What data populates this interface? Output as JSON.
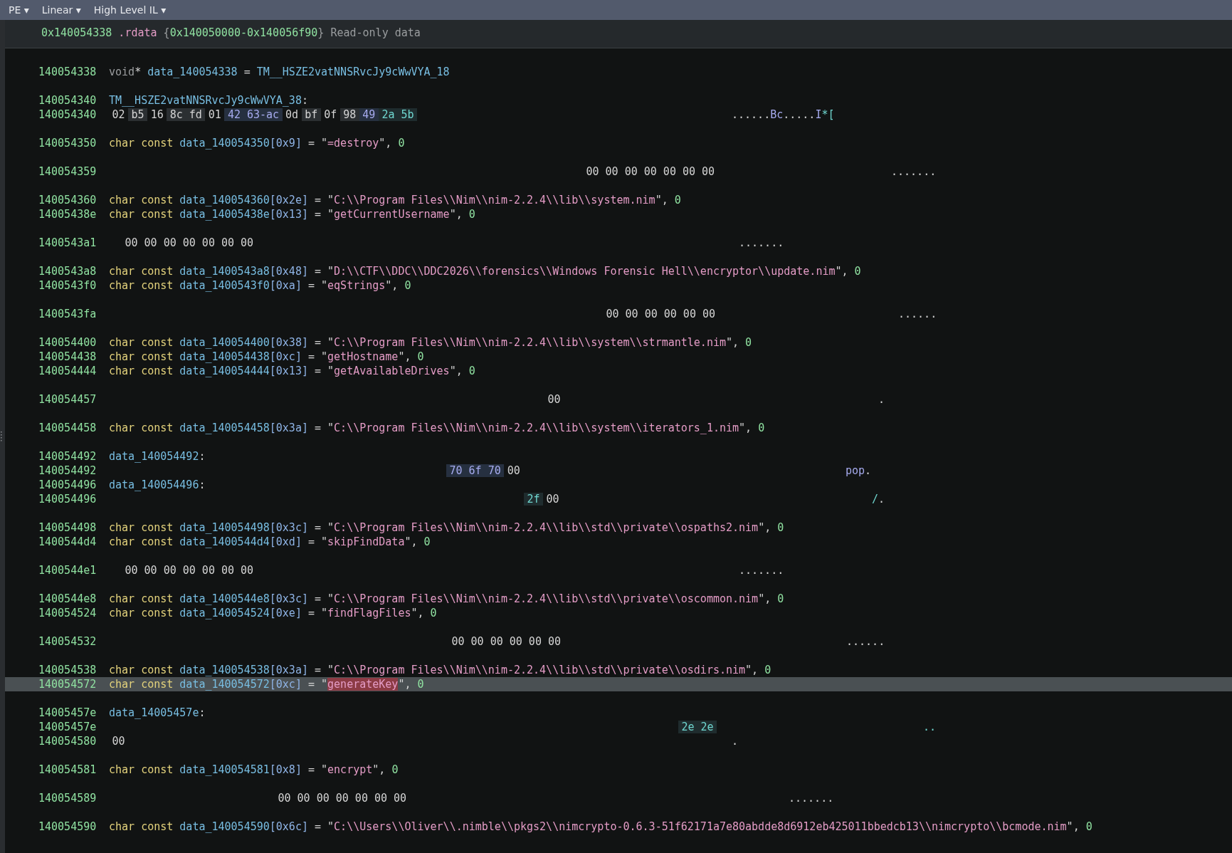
{
  "toolbar": {
    "menus": [
      {
        "label": "PE ▾"
      },
      {
        "label": "Linear ▾"
      },
      {
        "label": "High Level IL ▾"
      }
    ]
  },
  "section_header": {
    "segments": [
      {
        "text": "0x140054338",
        "kind": "number"
      },
      {
        "text": " .rdata",
        "kind": "string"
      },
      {
        "text": " {",
        "kind": "dim"
      },
      {
        "text": "0x140050000-0x140056f90",
        "kind": "number"
      },
      {
        "text": "} Read-only data",
        "kind": "dim"
      }
    ]
  },
  "blocks": [
    [
      {
        "address": "140054338",
        "kind": "code",
        "selected": false,
        "segments": [
          {
            "text": "void",
            "kind": "void"
          },
          {
            "text": "* ",
            "kind": "punct"
          },
          {
            "text": "data_140054338",
            "kind": "name"
          },
          {
            "text": " = ",
            "kind": "punct"
          },
          {
            "text": "TM__HSZE2vatNNSRvcJy9cWwVYA_18",
            "kind": "name"
          }
        ]
      }
    ],
    [
      {
        "address": "140054340",
        "kind": "code",
        "selected": false,
        "segments": [
          {
            "text": "TM__HSZE2vatNNSRvcJy9cWwVYA_38",
            "kind": "name"
          },
          {
            "text": ":",
            "kind": "punct"
          }
        ]
      },
      {
        "address": "140054340",
        "kind": "hex",
        "selected": false,
        "bytes": [
          {
            "text": "02",
            "kind": "plain"
          },
          {
            "text": "b5",
            "kind": "high"
          },
          {
            "text": "16",
            "kind": "plain"
          },
          {
            "text": "8c",
            "kind": "high"
          },
          {
            "text": "fd",
            "kind": "high"
          },
          {
            "text": "01",
            "kind": "plain"
          },
          {
            "text": "42",
            "kind": "letter"
          },
          {
            "text": "63-ac",
            "kind": "letter"
          },
          {
            "text": "0d",
            "kind": "plain"
          },
          {
            "text": "bf",
            "kind": "high"
          },
          {
            "text": "0f",
            "kind": "plain"
          },
          {
            "text": "98",
            "kind": "high"
          },
          {
            "text": "49",
            "kind": "letter"
          },
          {
            "text": "2a",
            "kind": "symbol"
          },
          {
            "text": "5b",
            "kind": "symbol"
          }
        ],
        "ascii": [
          {
            "text": "......",
            "kind": "plain"
          },
          {
            "text": "Bc",
            "kind": "letter"
          },
          {
            "text": ".....",
            "kind": "plain"
          },
          {
            "text": "I",
            "kind": "letter"
          },
          {
            "text": "*[",
            "kind": "symbol"
          }
        ]
      }
    ],
    [
      {
        "address": "140054350",
        "kind": "code",
        "selected": false,
        "segments": [
          {
            "text": "char const ",
            "kind": "type"
          },
          {
            "text": "data_140054350",
            "kind": "name"
          },
          {
            "text": "[0x9]",
            "kind": "index"
          },
          {
            "text": " = \"",
            "kind": "punct"
          },
          {
            "text": "=destroy",
            "kind": "string"
          },
          {
            "text": "\", ",
            "kind": "punct"
          },
          {
            "text": "0",
            "kind": "number"
          }
        ]
      }
    ],
    [
      {
        "address": "140054359",
        "kind": "hex",
        "selected": false,
        "bytes": [
          {
            "text": "00 00 00 00 00 00 00",
            "kind": "plain"
          }
        ],
        "ascii": [
          {
            "text": ".......",
            "kind": "plain"
          }
        ]
      }
    ],
    [
      {
        "address": "140054360",
        "kind": "code",
        "selected": false,
        "segments": [
          {
            "text": "char const ",
            "kind": "type"
          },
          {
            "text": "data_140054360",
            "kind": "name"
          },
          {
            "text": "[0x2e]",
            "kind": "index"
          },
          {
            "text": " = \"",
            "kind": "punct"
          },
          {
            "text": "C:\\\\Program Files\\\\Nim\\\\nim-2.2.4\\\\lib\\\\system.nim",
            "kind": "string"
          },
          {
            "text": "\", ",
            "kind": "punct"
          },
          {
            "text": "0",
            "kind": "number"
          }
        ]
      },
      {
        "address": "14005438e",
        "kind": "code",
        "selected": false,
        "segments": [
          {
            "text": "char const ",
            "kind": "type"
          },
          {
            "text": "data_14005438e",
            "kind": "name"
          },
          {
            "text": "[0x13]",
            "kind": "index"
          },
          {
            "text": " = \"",
            "kind": "punct"
          },
          {
            "text": "getCurrentUsername",
            "kind": "string"
          },
          {
            "text": "\", ",
            "kind": "punct"
          },
          {
            "text": "0",
            "kind": "number"
          }
        ]
      }
    ],
    [
      {
        "address": "1400543a1",
        "kind": "hex",
        "selected": false,
        "bytes": [
          {
            "text": "00 00 00 00 00 00 00",
            "kind": "plain"
          }
        ],
        "ascii": [
          {
            "text": ".......",
            "kind": "plain"
          }
        ]
      }
    ],
    [
      {
        "address": "1400543a8",
        "kind": "code",
        "selected": false,
        "segments": [
          {
            "text": "char const ",
            "kind": "type"
          },
          {
            "text": "data_1400543a8",
            "kind": "name"
          },
          {
            "text": "[0x48]",
            "kind": "index"
          },
          {
            "text": " = \"",
            "kind": "punct"
          },
          {
            "text": "D:\\\\CTF\\\\DDC\\\\DDC2026\\\\forensics\\\\Windows Forensic Hell\\\\encryptor\\\\update.nim",
            "kind": "string"
          },
          {
            "text": "\", ",
            "kind": "punct"
          },
          {
            "text": "0",
            "kind": "number"
          }
        ]
      },
      {
        "address": "1400543f0",
        "kind": "code",
        "selected": false,
        "segments": [
          {
            "text": "char const ",
            "kind": "type"
          },
          {
            "text": "data_1400543f0",
            "kind": "name"
          },
          {
            "text": "[0xa]",
            "kind": "index"
          },
          {
            "text": " = \"",
            "kind": "punct"
          },
          {
            "text": "eqStrings",
            "kind": "string"
          },
          {
            "text": "\", ",
            "kind": "punct"
          },
          {
            "text": "0",
            "kind": "number"
          }
        ]
      }
    ],
    [
      {
        "address": "1400543fa",
        "kind": "hex",
        "selected": false,
        "bytes": [
          {
            "text": "00 00 00 00 00 00",
            "kind": "plain"
          }
        ],
        "ascii": [
          {
            "text": "......",
            "kind": "plain"
          }
        ]
      }
    ],
    [
      {
        "address": "140054400",
        "kind": "code",
        "selected": false,
        "segments": [
          {
            "text": "char const ",
            "kind": "type"
          },
          {
            "text": "data_140054400",
            "kind": "name"
          },
          {
            "text": "[0x38]",
            "kind": "index"
          },
          {
            "text": " = \"",
            "kind": "punct"
          },
          {
            "text": "C:\\\\Program Files\\\\Nim\\\\nim-2.2.4\\\\lib\\\\system\\\\strmantle.nim",
            "kind": "string"
          },
          {
            "text": "\", ",
            "kind": "punct"
          },
          {
            "text": "0",
            "kind": "number"
          }
        ]
      },
      {
        "address": "140054438",
        "kind": "code",
        "selected": false,
        "segments": [
          {
            "text": "char const ",
            "kind": "type"
          },
          {
            "text": "data_140054438",
            "kind": "name"
          },
          {
            "text": "[0xc]",
            "kind": "index"
          },
          {
            "text": " = \"",
            "kind": "punct"
          },
          {
            "text": "getHostname",
            "kind": "string"
          },
          {
            "text": "\", ",
            "kind": "punct"
          },
          {
            "text": "0",
            "kind": "number"
          }
        ]
      },
      {
        "address": "140054444",
        "kind": "code",
        "selected": false,
        "segments": [
          {
            "text": "char const ",
            "kind": "type"
          },
          {
            "text": "data_140054444",
            "kind": "name"
          },
          {
            "text": "[0x13]",
            "kind": "index"
          },
          {
            "text": " = \"",
            "kind": "punct"
          },
          {
            "text": "getAvailableDrives",
            "kind": "string"
          },
          {
            "text": "\", ",
            "kind": "punct"
          },
          {
            "text": "0",
            "kind": "number"
          }
        ]
      }
    ],
    [
      {
        "address": "140054457",
        "kind": "hex",
        "selected": false,
        "bytes": [
          {
            "text": "00",
            "kind": "plain"
          }
        ],
        "ascii": [
          {
            "text": ".",
            "kind": "plain"
          }
        ]
      }
    ],
    [
      {
        "address": "140054458",
        "kind": "code",
        "selected": false,
        "segments": [
          {
            "text": "char const ",
            "kind": "type"
          },
          {
            "text": "data_140054458",
            "kind": "name"
          },
          {
            "text": "[0x3a]",
            "kind": "index"
          },
          {
            "text": " = \"",
            "kind": "punct"
          },
          {
            "text": "C:\\\\Program Files\\\\Nim\\\\nim-2.2.4\\\\lib\\\\system\\\\iterators_1.nim",
            "kind": "string"
          },
          {
            "text": "\", ",
            "kind": "punct"
          },
          {
            "text": "0",
            "kind": "number"
          }
        ]
      }
    ],
    [
      {
        "address": "140054492",
        "kind": "code",
        "selected": false,
        "segments": [
          {
            "text": "data_140054492",
            "kind": "name"
          },
          {
            "text": ":",
            "kind": "punct"
          }
        ]
      },
      {
        "address": "140054492",
        "kind": "hex",
        "selected": false,
        "bytes": [
          {
            "text": "70 6f 70",
            "kind": "letter"
          },
          {
            "text": "00",
            "kind": "plain"
          }
        ],
        "ascii": [
          {
            "text": "pop",
            "kind": "letter"
          },
          {
            "text": ".",
            "kind": "plain"
          }
        ]
      },
      {
        "address": "140054496",
        "kind": "code",
        "selected": false,
        "segments": [
          {
            "text": "data_140054496",
            "kind": "name"
          },
          {
            "text": ":",
            "kind": "punct"
          }
        ]
      },
      {
        "address": "140054496",
        "kind": "hex",
        "selected": false,
        "bytes": [
          {
            "text": "2f",
            "kind": "symbol"
          },
          {
            "text": "00",
            "kind": "plain"
          }
        ],
        "ascii": [
          {
            "text": "/",
            "kind": "symbol"
          },
          {
            "text": ".",
            "kind": "plain"
          }
        ]
      }
    ],
    [
      {
        "address": "140054498",
        "kind": "code",
        "selected": false,
        "segments": [
          {
            "text": "char const ",
            "kind": "type"
          },
          {
            "text": "data_140054498",
            "kind": "name"
          },
          {
            "text": "[0x3c]",
            "kind": "index"
          },
          {
            "text": " = \"",
            "kind": "punct"
          },
          {
            "text": "C:\\\\Program Files\\\\Nim\\\\nim-2.2.4\\\\lib\\\\std\\\\private\\\\ospaths2.nim",
            "kind": "string"
          },
          {
            "text": "\", ",
            "kind": "punct"
          },
          {
            "text": "0",
            "kind": "number"
          }
        ]
      },
      {
        "address": "1400544d4",
        "kind": "code",
        "selected": false,
        "segments": [
          {
            "text": "char const ",
            "kind": "type"
          },
          {
            "text": "data_1400544d4",
            "kind": "name"
          },
          {
            "text": "[0xd]",
            "kind": "index"
          },
          {
            "text": " = \"",
            "kind": "punct"
          },
          {
            "text": "skipFindData",
            "kind": "string"
          },
          {
            "text": "\", ",
            "kind": "punct"
          },
          {
            "text": "0",
            "kind": "number"
          }
        ]
      }
    ],
    [
      {
        "address": "1400544e1",
        "kind": "hex",
        "selected": false,
        "bytes": [
          {
            "text": "00 00 00 00 00 00 00",
            "kind": "plain"
          }
        ],
        "ascii": [
          {
            "text": ".......",
            "kind": "plain"
          }
        ]
      }
    ],
    [
      {
        "address": "1400544e8",
        "kind": "code",
        "selected": false,
        "segments": [
          {
            "text": "char const ",
            "kind": "type"
          },
          {
            "text": "data_1400544e8",
            "kind": "name"
          },
          {
            "text": "[0x3c]",
            "kind": "index"
          },
          {
            "text": " = \"",
            "kind": "punct"
          },
          {
            "text": "C:\\\\Program Files\\\\Nim\\\\nim-2.2.4\\\\lib\\\\std\\\\private\\\\oscommon.nim",
            "kind": "string"
          },
          {
            "text": "\", ",
            "kind": "punct"
          },
          {
            "text": "0",
            "kind": "number"
          }
        ]
      },
      {
        "address": "140054524",
        "kind": "code",
        "selected": false,
        "segments": [
          {
            "text": "char const ",
            "kind": "type"
          },
          {
            "text": "data_140054524",
            "kind": "name"
          },
          {
            "text": "[0xe]",
            "kind": "index"
          },
          {
            "text": " = \"",
            "kind": "punct"
          },
          {
            "text": "findFlagFiles",
            "kind": "string"
          },
          {
            "text": "\", ",
            "kind": "punct"
          },
          {
            "text": "0",
            "kind": "number"
          }
        ]
      }
    ],
    [
      {
        "address": "140054532",
        "kind": "hex",
        "selected": false,
        "bytes": [
          {
            "text": "00 00 00 00 00 00",
            "kind": "plain"
          }
        ],
        "ascii": [
          {
            "text": "......",
            "kind": "plain"
          }
        ]
      }
    ],
    [
      {
        "address": "140054538",
        "kind": "code",
        "selected": false,
        "segments": [
          {
            "text": "char const ",
            "kind": "type"
          },
          {
            "text": "data_140054538",
            "kind": "name"
          },
          {
            "text": "[0x3a]",
            "kind": "index"
          },
          {
            "text": " = \"",
            "kind": "punct"
          },
          {
            "text": "C:\\\\Program Files\\\\Nim\\\\nim-2.2.4\\\\lib\\\\std\\\\private\\\\osdirs.nim",
            "kind": "string"
          },
          {
            "text": "\", ",
            "kind": "punct"
          },
          {
            "text": "0",
            "kind": "number"
          }
        ]
      },
      {
        "address": "140054572",
        "kind": "code",
        "selected": true,
        "segments": [
          {
            "text": "char const ",
            "kind": "type"
          },
          {
            "text": "data_140054572",
            "kind": "name"
          },
          {
            "text": "[0xc]",
            "kind": "index"
          },
          {
            "text": " = \"",
            "kind": "punct"
          },
          {
            "text": "generateKey",
            "kind": "match"
          },
          {
            "text": "\", ",
            "kind": "punct"
          },
          {
            "text": "0",
            "kind": "number"
          }
        ]
      }
    ],
    [
      {
        "address": "14005457e",
        "kind": "code",
        "selected": false,
        "segments": [
          {
            "text": "data_14005457e",
            "kind": "name"
          },
          {
            "text": ":",
            "kind": "punct"
          }
        ]
      },
      {
        "address": "14005457e",
        "kind": "hex",
        "selected": false,
        "bytes": [
          {
            "text": "2e 2e",
            "kind": "symbol"
          }
        ],
        "ascii": [
          {
            "text": "..",
            "kind": "symbol"
          }
        ]
      },
      {
        "address": "140054580",
        "kind": "hex",
        "selected": false,
        "bytes": [
          {
            "text": "00",
            "kind": "plain"
          }
        ],
        "ascii": [
          {
            "text": ".",
            "kind": "plain"
          }
        ]
      }
    ],
    [
      {
        "address": "140054581",
        "kind": "code",
        "selected": false,
        "segments": [
          {
            "text": "char const ",
            "kind": "type"
          },
          {
            "text": "data_140054581",
            "kind": "name"
          },
          {
            "text": "[0x8]",
            "kind": "index"
          },
          {
            "text": " = \"",
            "kind": "punct"
          },
          {
            "text": "encrypt",
            "kind": "string"
          },
          {
            "text": "\", ",
            "kind": "punct"
          },
          {
            "text": "0",
            "kind": "number"
          }
        ]
      }
    ],
    [
      {
        "address": "140054589",
        "kind": "hex",
        "selected": false,
        "bytes": [
          {
            "text": "00 00 00 00 00 00 00",
            "kind": "plain"
          }
        ],
        "ascii": [
          {
            "text": ".......",
            "kind": "plain"
          }
        ]
      }
    ],
    [
      {
        "address": "140054590",
        "kind": "code",
        "selected": false,
        "segments": [
          {
            "text": "char const ",
            "kind": "type"
          },
          {
            "text": "data_140054590",
            "kind": "name"
          },
          {
            "text": "[0x6c]",
            "kind": "index"
          },
          {
            "text": " = \"",
            "kind": "punct"
          },
          {
            "text": "C:\\\\Users\\\\Oliver\\\\.nimble\\\\pkgs2\\\\nimcrypto-0.6.3-51f62171a7e80abdde8d6912eb425011bbedcb13\\\\nimcrypto\\\\bcmode.nim",
            "kind": "string"
          },
          {
            "text": "\", ",
            "kind": "punct"
          },
          {
            "text": "0",
            "kind": "number"
          }
        ]
      }
    ]
  ]
}
